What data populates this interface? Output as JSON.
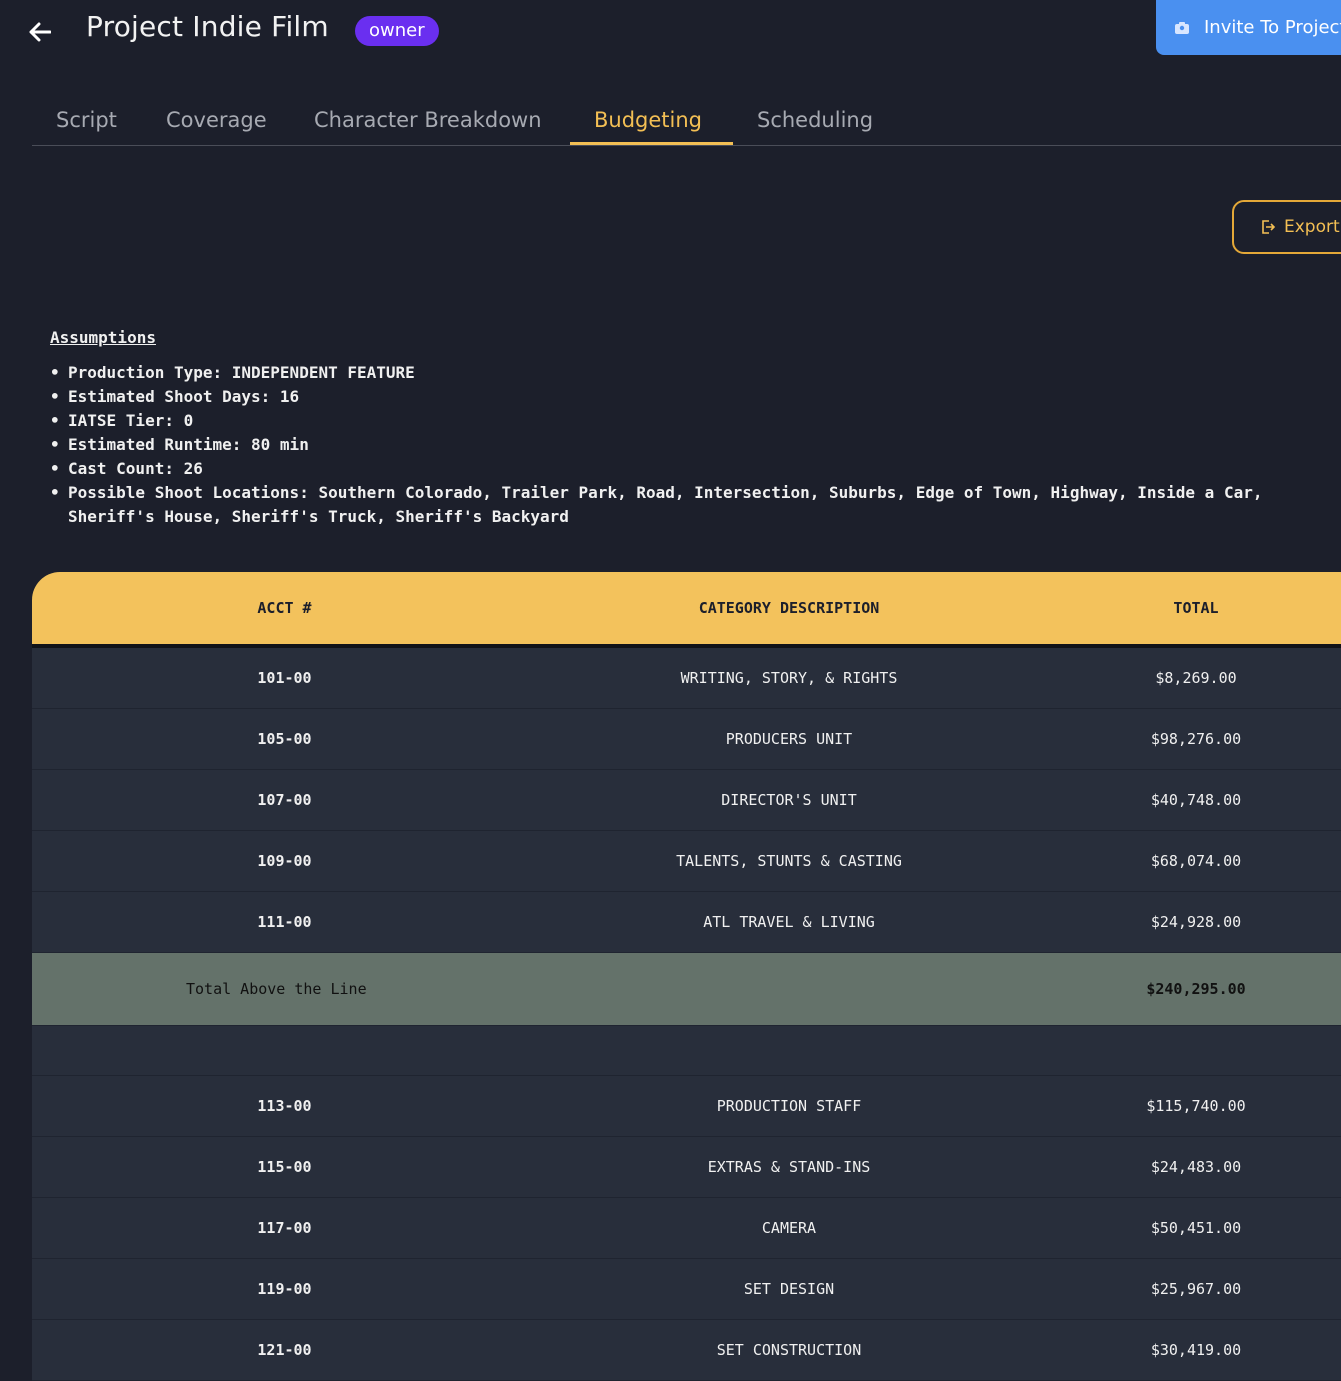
{
  "header": {
    "title": "Project Indie Film",
    "role_badge": "owner",
    "invite_label": "Invite To Project"
  },
  "tabs": [
    {
      "label": "Script"
    },
    {
      "label": "Coverage"
    },
    {
      "label": "Character Breakdown"
    },
    {
      "label": "Budgeting",
      "active": true
    },
    {
      "label": "Scheduling"
    }
  ],
  "export_label": "Export",
  "assumptions": {
    "heading": "Assumptions",
    "items": [
      "Production Type: INDEPENDENT FEATURE",
      "Estimated Shoot Days: 16",
      "IATSE Tier: 0",
      "Estimated Runtime: 80 min",
      "Cast Count: 26",
      "Possible Shoot Locations: Southern Colorado, Trailer Park, Road, Intersection, Suburbs, Edge of Town, Highway, Inside a Car, Sheriff's House, Sheriff's Truck, Sheriff's Backyard"
    ]
  },
  "table": {
    "columns": [
      "ACCT #",
      "CATEGORY DESCRIPTION",
      "TOTAL"
    ],
    "above_the_line": [
      {
        "acct": "101-00",
        "desc": "WRITING, STORY, & RIGHTS",
        "total": "$8,269.00"
      },
      {
        "acct": "105-00",
        "desc": "PRODUCERS UNIT",
        "total": "$98,276.00"
      },
      {
        "acct": "107-00",
        "desc": "DIRECTOR'S UNIT",
        "total": "$40,748.00"
      },
      {
        "acct": "109-00",
        "desc": "TALENTS, STUNTS & CASTING",
        "total": "$68,074.00"
      },
      {
        "acct": "111-00",
        "desc": "ATL TRAVEL & LIVING",
        "total": "$24,928.00"
      }
    ],
    "total_above_label": "Total Above the Line",
    "total_above_value": "$240,295.00",
    "below_the_line": [
      {
        "acct": "113-00",
        "desc": "PRODUCTION STAFF",
        "total": "$115,740.00"
      },
      {
        "acct": "115-00",
        "desc": "EXTRAS & STAND-INS",
        "total": "$24,483.00"
      },
      {
        "acct": "117-00",
        "desc": "CAMERA",
        "total": "$50,451.00"
      },
      {
        "acct": "119-00",
        "desc": "SET DESIGN",
        "total": "$25,967.00"
      },
      {
        "acct": "121-00",
        "desc": "SET CONSTRUCTION",
        "total": "$30,419.00"
      }
    ]
  },
  "colors": {
    "background": "#1c1f2b",
    "accent": "#f3bf54",
    "badge": "#6a2ff0",
    "invite": "#4a90f0",
    "row": "#282e3b",
    "total_row": "#64726a"
  }
}
